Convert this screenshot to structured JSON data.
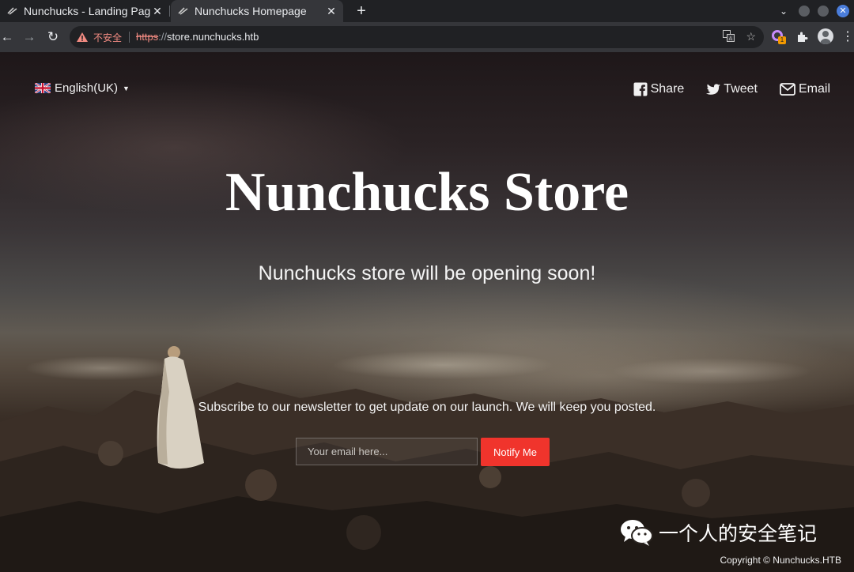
{
  "browser": {
    "tabs": [
      {
        "title": "Nunchucks - Landing Pag",
        "active": false
      },
      {
        "title": "Nunchucks Homepage",
        "active": true
      }
    ],
    "new_tab": "+",
    "address": {
      "security_label": "不安全",
      "scheme": "https",
      "separator": "://",
      "host": "store.nunchucks.htb"
    },
    "extension_badge": "1"
  },
  "page": {
    "language": "English(UK)",
    "share": [
      {
        "label": "Share",
        "icon": "facebook-icon"
      },
      {
        "label": "Tweet",
        "icon": "twitter-icon"
      },
      {
        "label": "Email",
        "icon": "envelope-icon"
      }
    ],
    "title": "Nunchucks Store",
    "subtitle": "Nunchucks store will be opening soon!",
    "newsletter_text": "Subscribe to our newsletter to get update on our launch. We will keep you posted.",
    "email_placeholder": "Your email here...",
    "notify_label": "Notify Me",
    "watermark": "一个人的安全笔记",
    "copyright": "Copyright © Nunchucks.HTB"
  },
  "colors": {
    "notify_button": "#f0342c",
    "insecure_text": "#f28b82"
  }
}
